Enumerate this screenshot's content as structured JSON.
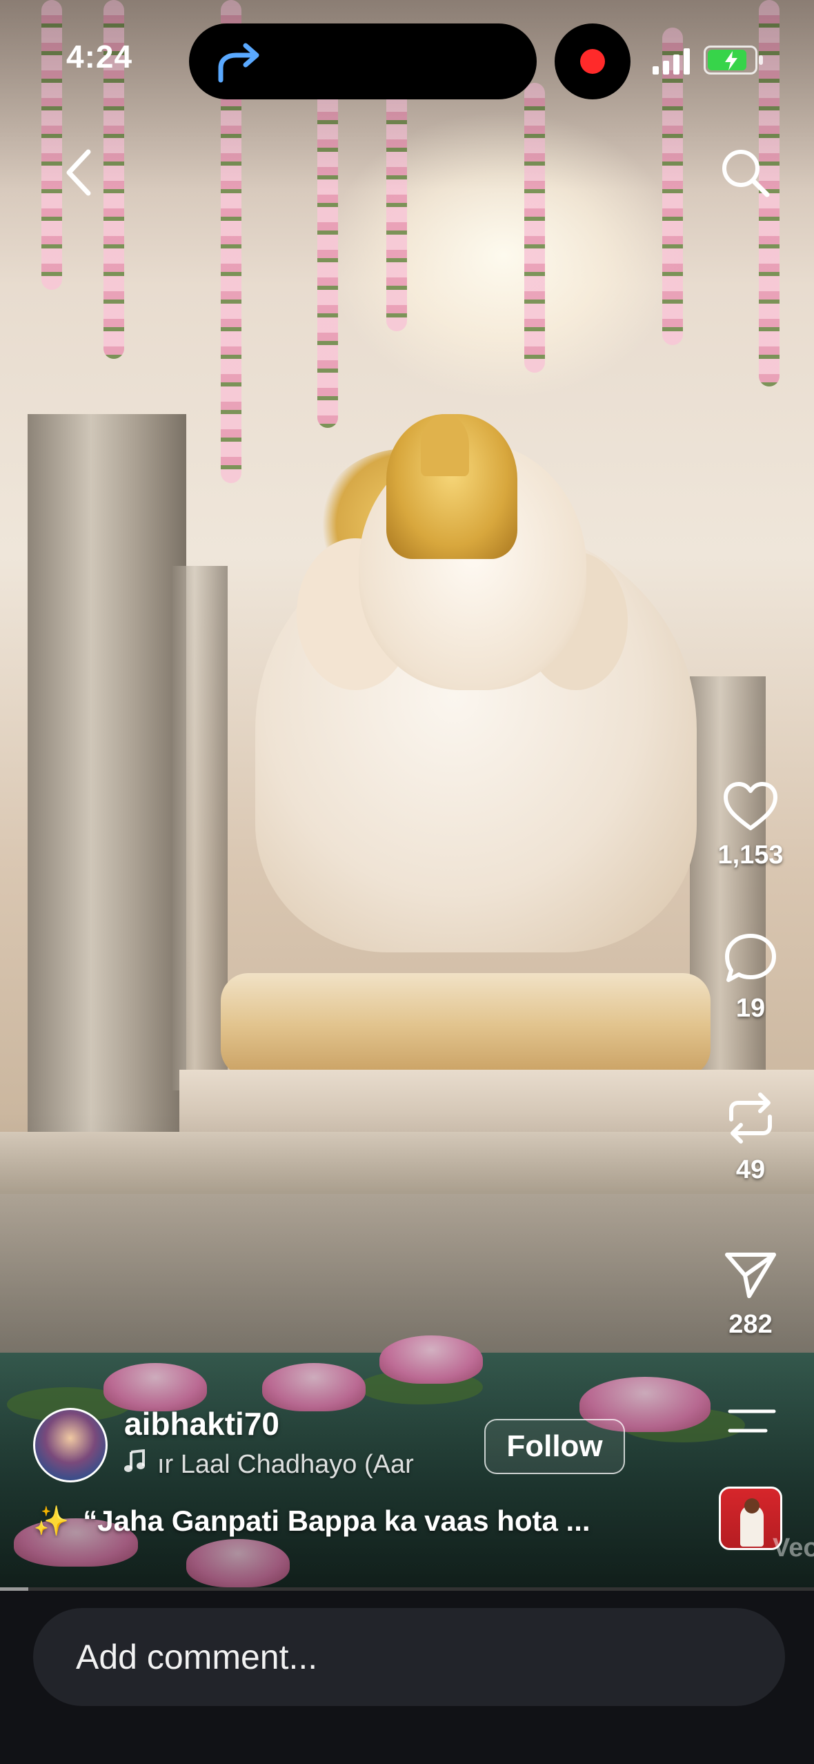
{
  "status_bar": {
    "time": "4:24",
    "battery_level": 0.85,
    "battery_color": "#37d44a",
    "recording_color": "#ff2a2a"
  },
  "nav": {
    "back_icon": "chevron-left-icon",
    "search_icon": "search-icon"
  },
  "actions": {
    "like_count": "1,153",
    "comment_count": "19",
    "repost_count": "49",
    "share_count": "282"
  },
  "post": {
    "username": "aibhakti70",
    "music": "ır Laal Chadhayo (Aar",
    "follow_label": "Follow",
    "caption_emoji": "✨",
    "caption": "“Jaha Ganpati Bappa ka vaas hota ...",
    "watermark": "Veo"
  },
  "video": {
    "progress": 0.035
  },
  "comment_bar": {
    "placeholder": "Add comment..."
  }
}
